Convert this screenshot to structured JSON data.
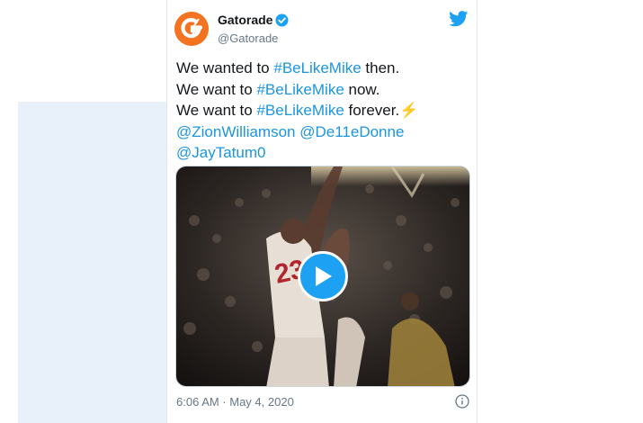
{
  "tweet": {
    "display_name": "Gatorade",
    "handle": "@Gatorade",
    "lines": [
      {
        "pre": "We wanted to ",
        "tag": "#BeLikeMike",
        "post": " then."
      },
      {
        "pre": "We want to ",
        "tag": "#BeLikeMike",
        "post": " now."
      },
      {
        "pre": "We want to ",
        "tag": "#BeLikeMike",
        "post": " forever.⚡"
      }
    ],
    "mentions_line1": "@ZionWilliamson @De11eDonne",
    "mentions_line2": "@JayTatum0",
    "timestamp": "6:06 AM · May 4, 2020"
  },
  "icons": {
    "avatar": "gatorade-logo-icon",
    "verified": "verified-badge-icon",
    "brand": "twitter-bird-icon",
    "play": "play-icon",
    "info": "info-icon"
  },
  "colors": {
    "brand_orange": "#f47321",
    "link_blue": "#1b95e0",
    "twitter_blue": "#1da1f2",
    "background_band": "#e8f0f9"
  }
}
